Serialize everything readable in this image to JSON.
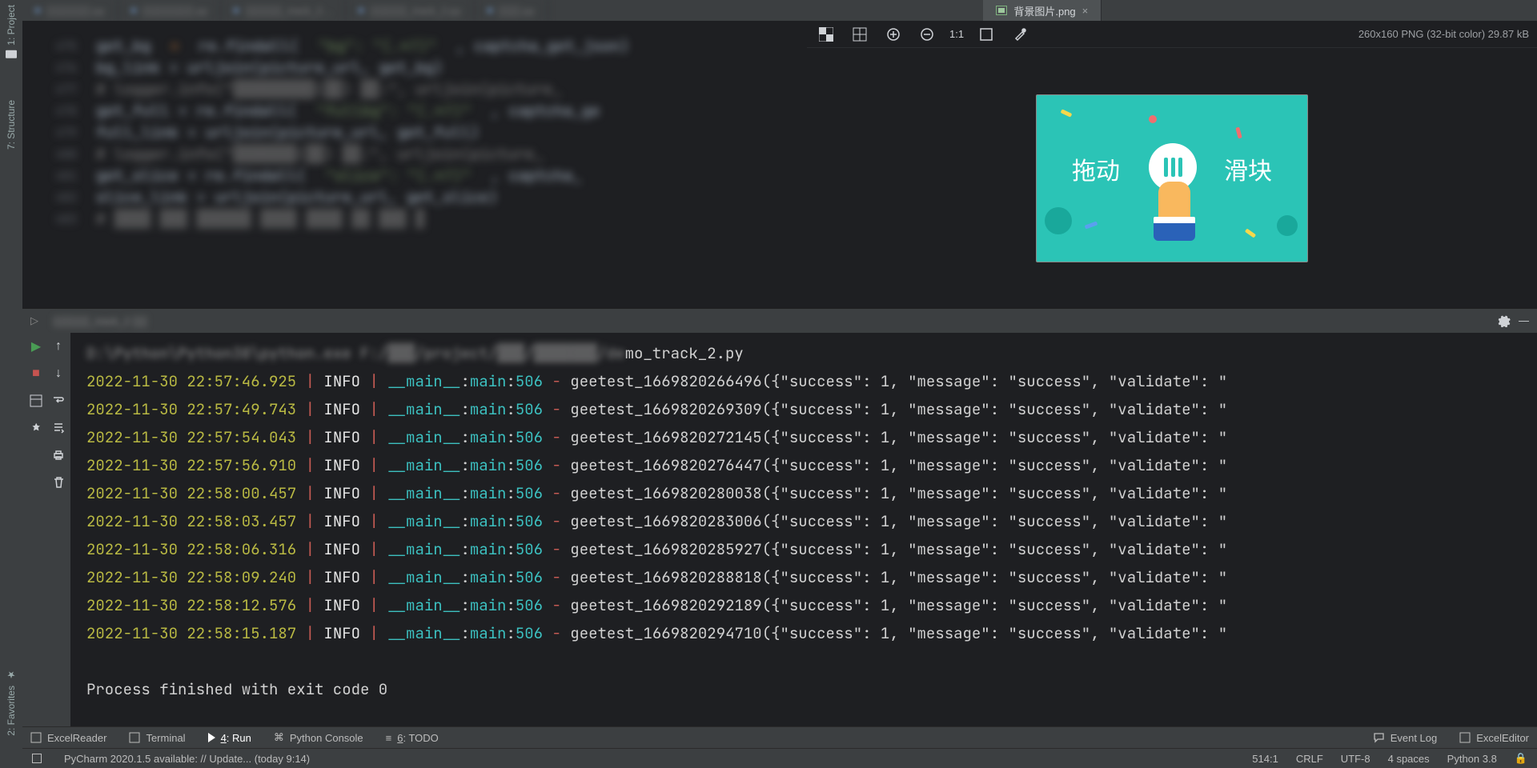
{
  "left_tools": {
    "project": "1: Project",
    "structure": "7: Structure",
    "favorites": "2: Favorites"
  },
  "tabs": {
    "blurred": [
      "▒▒▒▒▒▒.py",
      "▒▒▒▒▒▒▒.py",
      "▒▒▒▒▒_track_2…",
      "▒▒▒▒▒_track_2.py",
      "▒▒▒.py"
    ],
    "active": "背景图片.png"
  },
  "image_toolbar": {
    "info": "260x160 PNG (32-bit color) 29.87 kB",
    "ratio": "1:1"
  },
  "captcha": {
    "left": "拖动",
    "right": "滑块"
  },
  "run_header": {
    "name": "▒▒▒▒▒_track_2 ▒▒"
  },
  "console_cmd_tail": "mo_track_2.py",
  "logs": [
    {
      "ts": "2022-11-30 22:57:46.925",
      "lvl": "INFO",
      "mod": "__main__",
      "fn": "main",
      "ln": "506",
      "msg": "geetest_1669820266496({\"success\": 1, \"message\": \"success\", \"validate\": \""
    },
    {
      "ts": "2022-11-30 22:57:49.743",
      "lvl": "INFO",
      "mod": "__main__",
      "fn": "main",
      "ln": "506",
      "msg": "geetest_1669820269309({\"success\": 1, \"message\": \"success\", \"validate\": \""
    },
    {
      "ts": "2022-11-30 22:57:54.043",
      "lvl": "INFO",
      "mod": "__main__",
      "fn": "main",
      "ln": "506",
      "msg": "geetest_1669820272145({\"success\": 1, \"message\": \"success\", \"validate\": \""
    },
    {
      "ts": "2022-11-30 22:57:56.910",
      "lvl": "INFO",
      "mod": "__main__",
      "fn": "main",
      "ln": "506",
      "msg": "geetest_1669820276447({\"success\": 1, \"message\": \"success\", \"validate\": \""
    },
    {
      "ts": "2022-11-30 22:58:00.457",
      "lvl": "INFO",
      "mod": "__main__",
      "fn": "main",
      "ln": "506",
      "msg": "geetest_1669820280038({\"success\": 1, \"message\": \"success\", \"validate\": \""
    },
    {
      "ts": "2022-11-30 22:58:03.457",
      "lvl": "INFO",
      "mod": "__main__",
      "fn": "main",
      "ln": "506",
      "msg": "geetest_1669820283006({\"success\": 1, \"message\": \"success\", \"validate\": \""
    },
    {
      "ts": "2022-11-30 22:58:06.316",
      "lvl": "INFO",
      "mod": "__main__",
      "fn": "main",
      "ln": "506",
      "msg": "geetest_1669820285927({\"success\": 1, \"message\": \"success\", \"validate\": \""
    },
    {
      "ts": "2022-11-30 22:58:09.240",
      "lvl": "INFO",
      "mod": "__main__",
      "fn": "main",
      "ln": "506",
      "msg": "geetest_1669820288818({\"success\": 1, \"message\": \"success\", \"validate\": \""
    },
    {
      "ts": "2022-11-30 22:58:12.576",
      "lvl": "INFO",
      "mod": "__main__",
      "fn": "main",
      "ln": "506",
      "msg": "geetest_1669820292189({\"success\": 1, \"message\": \"success\", \"validate\": \""
    },
    {
      "ts": "2022-11-30 22:58:15.187",
      "lvl": "INFO",
      "mod": "__main__",
      "fn": "main",
      "ln": "506",
      "msg": "geetest_1669820294710({\"success\": 1, \"message\": \"success\", \"validate\": \""
    }
  ],
  "exit_line": "Process finished with exit code 0",
  "bottom_tabs": {
    "excel_reader": "ExcelReader",
    "terminal": "Terminal",
    "run": "4: Run",
    "python_console": "Python Console",
    "todo": "6: TODO",
    "event_log": "Event Log",
    "excel_editor": "ExcelEditor"
  },
  "status_bar": {
    "update": "PyCharm 2020.1.5 available: // Update... (today 9:14)",
    "caret": "514:1",
    "line_sep": "CRLF",
    "encoding": "UTF-8",
    "indent": "4 spaces",
    "interpreter": "Python 3.8"
  }
}
